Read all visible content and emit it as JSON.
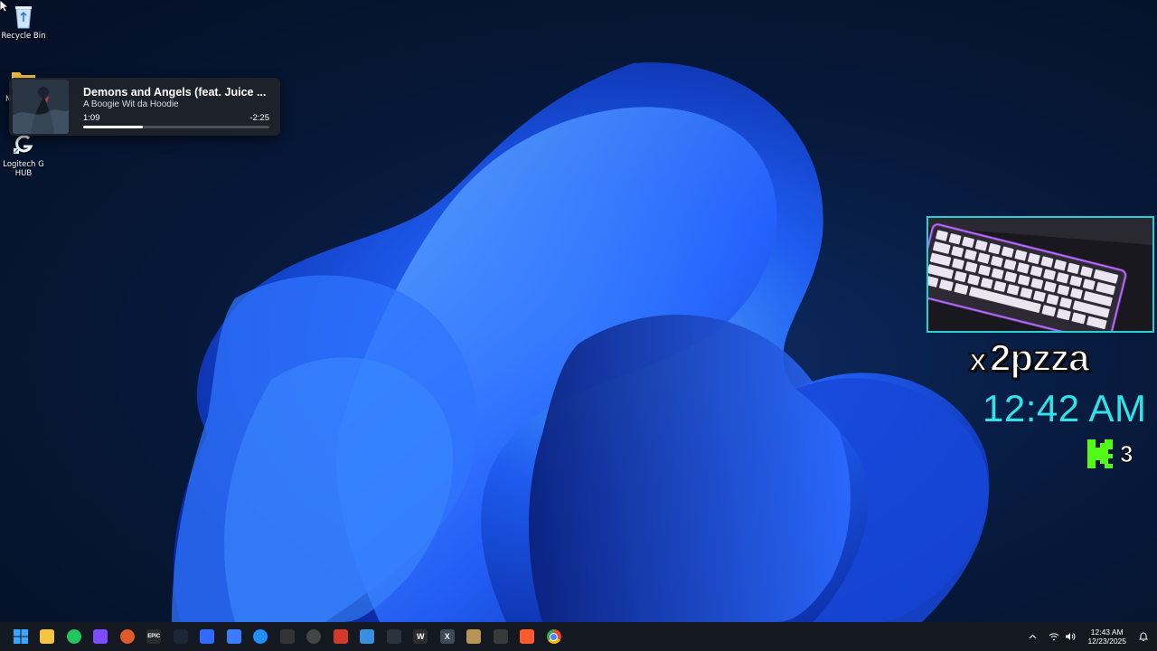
{
  "desktop": {
    "icons": [
      {
        "label": "Recycle Bin",
        "icon": "recycle-bin-icon"
      },
      {
        "label": "Ne",
        "icon": "folder-icon"
      },
      {
        "label": "Logitech G HUB",
        "icon": "logitech-g-hub-icon"
      }
    ]
  },
  "media": {
    "title": "Demons and Angels (feat. Juice ...",
    "artist": "A Boogie Wit da Hoodie",
    "elapsed": "1:09",
    "remaining": "-2:25",
    "progress": 0.32
  },
  "stream_overlay": {
    "username": "2pzza",
    "username_prefix": "x",
    "clock": "12:42 AM",
    "kick_count": "3",
    "accent": "#2fe3e6",
    "kick_color": "#53fc18"
  },
  "taskbar": {
    "apps": [
      {
        "name": "start-icon",
        "color": "#2ea7ff"
      },
      {
        "name": "file-explorer-icon",
        "color": "#f5c342"
      },
      {
        "name": "xbox-icon",
        "color": "#22c55e"
      },
      {
        "name": "app-menu-icon",
        "color": "#7c4dff"
      },
      {
        "name": "red-app-icon",
        "color": "#e05a2a"
      },
      {
        "name": "epic-games-icon",
        "color": "#2b2b2b",
        "text": "EPIC"
      },
      {
        "name": "steam-icon",
        "color": "#1b2838"
      },
      {
        "name": "blue-app-icon",
        "color": "#2f6bff"
      },
      {
        "name": "blue-square-icon",
        "color": "#3a7bff"
      },
      {
        "name": "edge-icon",
        "color": "#1e90ff"
      },
      {
        "name": "cursor-app-icon",
        "color": "#333333"
      },
      {
        "name": "obs-icon",
        "color": "#444444"
      },
      {
        "name": "red-bars-icon",
        "color": "#d33a2c"
      },
      {
        "name": "blue-bars-icon",
        "color": "#3b8fe0"
      },
      {
        "name": "gear-icon",
        "color": "#2c3340"
      },
      {
        "name": "w-app-icon",
        "color": "#2c2c2c",
        "text": "W"
      },
      {
        "name": "x-app-icon",
        "color": "#3a4a5a",
        "text": "X"
      },
      {
        "name": "gold-app-icon",
        "color": "#b89457"
      },
      {
        "name": "dark-app-icon",
        "color": "#3a3a3a"
      },
      {
        "name": "brave-icon",
        "color": "#ff5a2a"
      },
      {
        "name": "chrome-icon",
        "color": "#34a853"
      }
    ],
    "time": "12:43 AM",
    "date": "12/23/2025"
  }
}
